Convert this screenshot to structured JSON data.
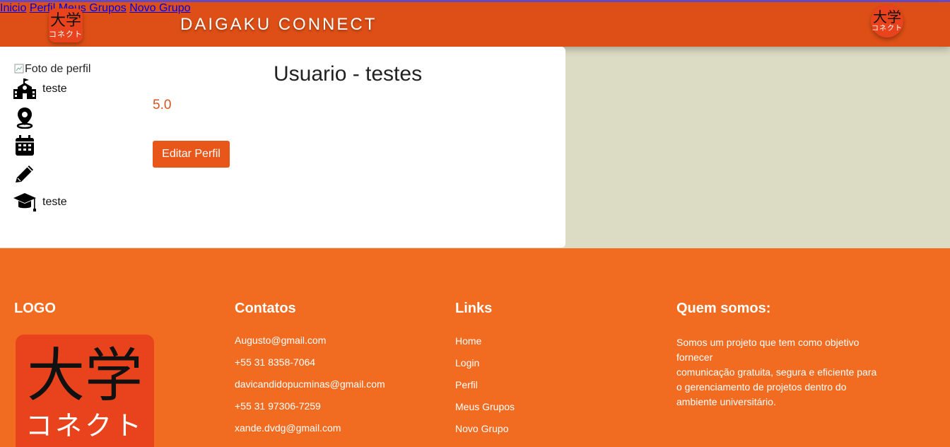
{
  "header": {
    "logo_kanji": "大学",
    "logo_kana": "コネクト",
    "brand": "DAIGAKU CONNECT",
    "nav": [
      "Inicio",
      "Perfil",
      "Meus Grupos",
      "Novo Grupo"
    ],
    "colors": {
      "bar": "#dd4f16",
      "accent_line": "#6a4cc4"
    }
  },
  "profile": {
    "photo_alt": "Foto de perfil",
    "title": "Usuario - testes",
    "rating": "5.0",
    "edit_button": "Editar Perfil",
    "fields": [
      {
        "icon": "school-icon",
        "value": "teste"
      },
      {
        "icon": "location-pin-icon",
        "value": ""
      },
      {
        "icon": "calendar-icon",
        "value": ""
      },
      {
        "icon": "pencil-icon",
        "value": ""
      },
      {
        "icon": "graduation-cap-icon",
        "value": "teste"
      }
    ]
  },
  "footer": {
    "logo_heading": "LOGO",
    "contacts_heading": "Contatos",
    "contacts": [
      "Augusto@gmail.com",
      "+55 31 8358-7064",
      "davicandidopucminas@gmail.com",
      "+55 31 97306-7259",
      "xande.dvdg@gmail.com"
    ],
    "links_heading": "Links",
    "links": [
      "Home",
      "Login",
      "Perfil",
      "Meus Grupos",
      "Novo Grupo"
    ],
    "about_heading": "Quem somos:",
    "about_lines": [
      "Somos um projeto que tem como objetivo",
      "fornecer",
      "comunicação gratuita, segura e eficiente para",
      "o gerenciamento de projetos dentro do",
      "ambiente universitário."
    ],
    "color": "#f16c21"
  }
}
